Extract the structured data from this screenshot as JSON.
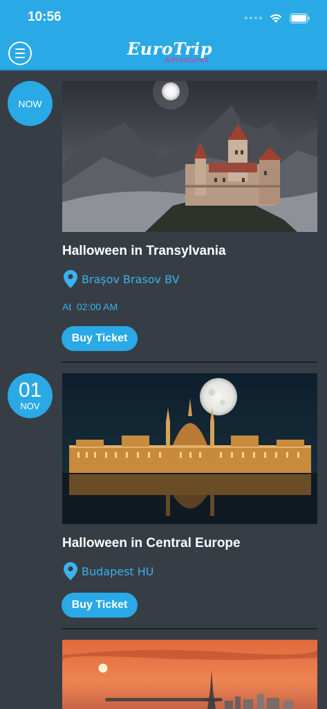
{
  "status_bar": {
    "time": "10:56"
  },
  "header": {
    "logo_main": "EuroTrip",
    "logo_sub": "Adventures",
    "menu_icon": "hamburger-circle-icon"
  },
  "colors": {
    "accent": "#29a9e6",
    "background": "#363d45",
    "link": "#3ab3ee"
  },
  "events": [
    {
      "badge": "NOW",
      "title": "Halloween in Transylvania",
      "location": "Brașov Brasov BV",
      "time_prefix": "At",
      "time": "02:00 AM",
      "button": "Buy Ticket"
    },
    {
      "badge_day": "01",
      "badge_month": "NOV",
      "title": "Halloween in Central Europe",
      "location": "Budapest HU",
      "button": "Buy Ticket"
    }
  ]
}
